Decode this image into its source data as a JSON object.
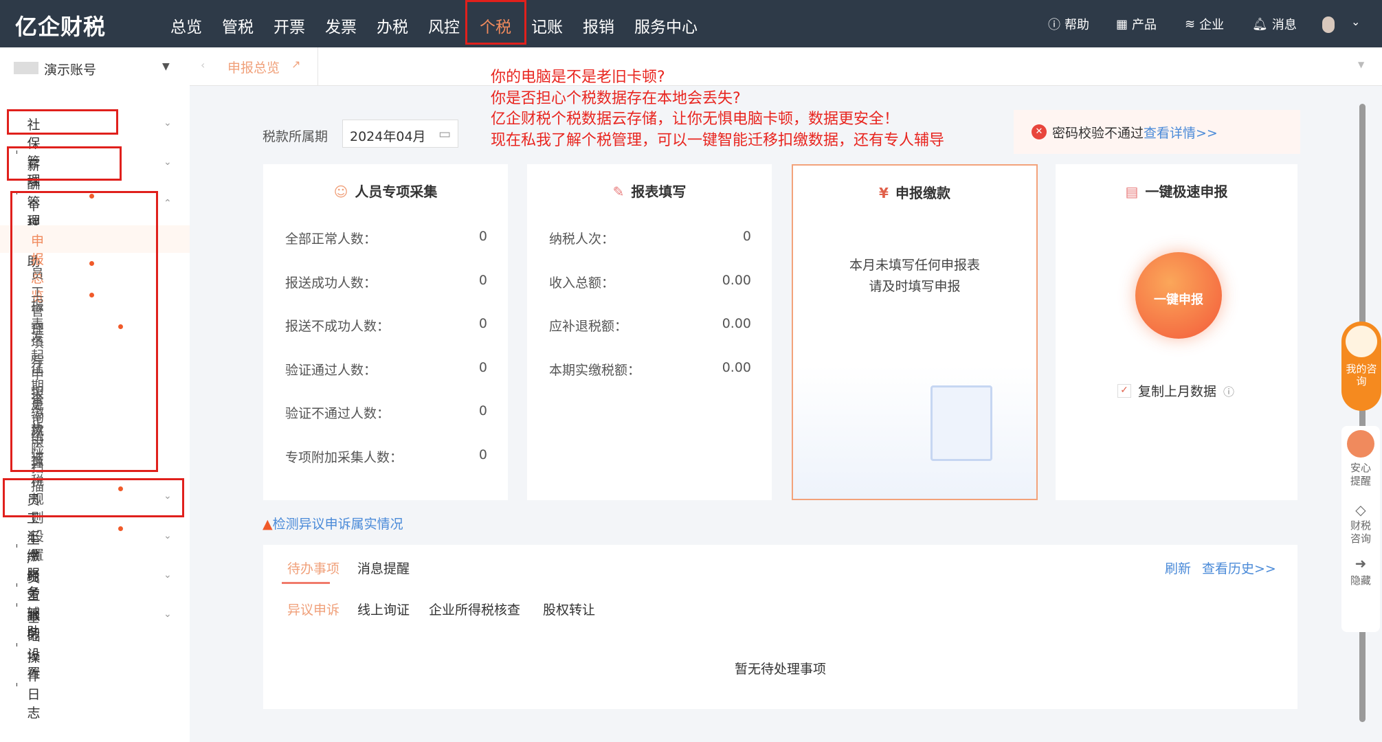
{
  "header": {
    "logo": "亿企财税",
    "nav": [
      "总览",
      "管税",
      "开票",
      "发票",
      "办税",
      "风控",
      "个税",
      "记账",
      "报销",
      "服务中心"
    ],
    "active_nav": "个税",
    "right": [
      {
        "icon": "help-icon",
        "label": "帮助"
      },
      {
        "icon": "grid-icon",
        "label": "产品"
      },
      {
        "icon": "layers-icon",
        "label": "企业"
      },
      {
        "icon": "bell-icon",
        "label": "消息"
      }
    ]
  },
  "sidebar": {
    "account": "演示账号",
    "items": [
      {
        "label": "社保管理"
      },
      {
        "label": "薪酬管理"
      },
      {
        "label": "个税辅助"
      },
      {
        "label": "员工汇缴服务"
      },
      {
        "label": "生产经营辅助"
      },
      {
        "label": "员工服务"
      },
      {
        "label": "基础设置"
      },
      {
        "label": "操作日志"
      }
    ],
    "sub_items": [
      "申报总览",
      "员工管理",
      "报表填写",
      "发起申报缴款",
      "往期更正申报",
      "查询统计",
      "风险扫描",
      "算税规则设置"
    ]
  },
  "tabs": {
    "active": "申报总览"
  },
  "annotation": [
    "你的电脑是不是老旧卡顿?",
    "你是否担心个税数据存在本地会丢失?",
    "亿企财税个税数据云存储，让你无惧电脑卡顿，数据更安全！",
    "现在私我了解个税管理，可以一键智能迁移扣缴数据，还有专人辅导"
  ],
  "period": {
    "label": "税款所属期",
    "value": "2024年04月"
  },
  "alert": {
    "text": "密码校验不通过",
    "link": "查看详情>>"
  },
  "cards": {
    "collect": {
      "title": "人员专项采集",
      "rows": [
        {
          "label": "全部正常人数：",
          "value": "0"
        },
        {
          "label": "报送成功人数：",
          "value": "0"
        },
        {
          "label": "报送不成功人数：",
          "value": "0"
        },
        {
          "label": "验证通过人数：",
          "value": "0"
        },
        {
          "label": "验证不通过人数：",
          "value": "0"
        },
        {
          "label": "专项附加采集人数：",
          "value": "0"
        }
      ]
    },
    "fill": {
      "title": "报表填写",
      "rows": [
        {
          "label": "纳税人次：",
          "value": "0"
        },
        {
          "label": "收入总额：",
          "value": "0.00"
        },
        {
          "label": "应补退税额：",
          "value": "0.00"
        },
        {
          "label": "本期实缴税额：",
          "value": "0.00"
        }
      ]
    },
    "pay": {
      "title": "申报缴款",
      "msg1": "本月未填写任何申报表",
      "msg2": "请及时填写申报"
    },
    "quick": {
      "title": "一键极速申报",
      "button": "一键申报",
      "copy": "复制上月数据"
    }
  },
  "check_link": "检测异议申诉属实情况",
  "todo": {
    "tabs": [
      "待办事项",
      "消息提醒"
    ],
    "refresh": "刷新",
    "history": "查看历史>>",
    "subtabs": [
      "异议申诉",
      "线上询证",
      "企业所得税核查",
      "股权转让"
    ],
    "empty": "暂无待处理事项"
  },
  "float": [
    {
      "label": "我的咨询"
    },
    {
      "label": "安心提醒"
    },
    {
      "label": "财税咨询"
    },
    {
      "label": "隐藏"
    }
  ]
}
